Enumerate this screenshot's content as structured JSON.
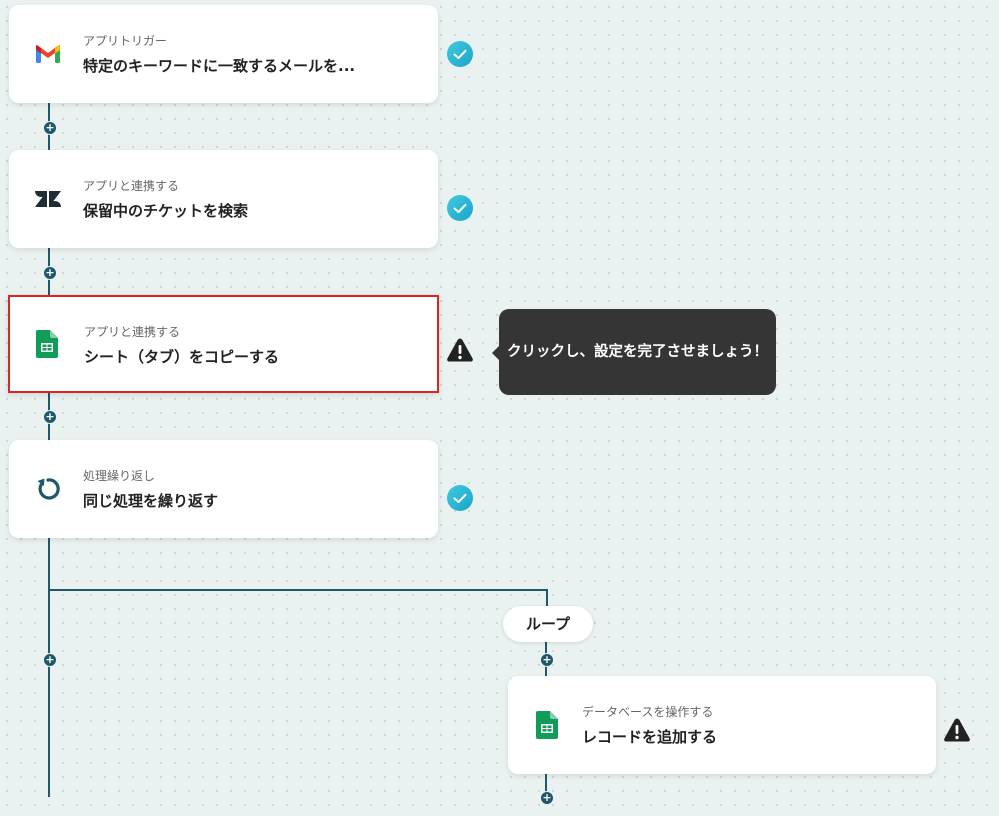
{
  "flow": {
    "steps": [
      {
        "subtitle": "アプリトリガー",
        "title": "特定のキーワードに一致するメールを...",
        "icon": "gmail-icon",
        "status": "complete"
      },
      {
        "subtitle": "アプリと連携する",
        "title": "保留中のチケットを検索",
        "icon": "zendesk-icon",
        "status": "complete"
      },
      {
        "subtitle": "アプリと連携する",
        "title": "シート（タブ）をコピーする",
        "icon": "google-sheets-icon",
        "status": "warning",
        "selected": true
      },
      {
        "subtitle": "処理繰り返し",
        "title": "同じ処理を繰り返す",
        "icon": "loop-icon",
        "status": "complete"
      }
    ],
    "loop": {
      "label": "ループ",
      "steps": [
        {
          "subtitle": "データベースを操作する",
          "title": "レコードを追加する",
          "icon": "google-sheets-icon",
          "status": "warning"
        }
      ]
    }
  },
  "tooltip": {
    "text": "クリックし、設定を完了させましょう！"
  },
  "colors": {
    "line": "#1f5868",
    "check": "#22b3d3",
    "warning": "#222222",
    "selected_border": "#e02424",
    "tooltip_bg": "#353535"
  }
}
